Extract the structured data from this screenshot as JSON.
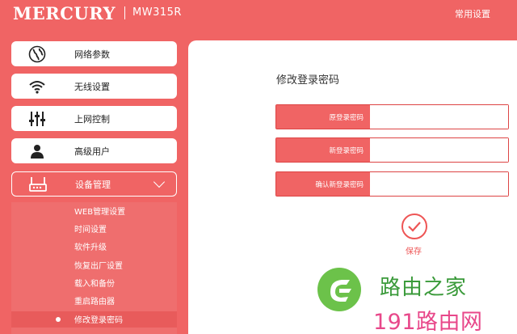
{
  "header": {
    "brand": "MERCURY",
    "model": "MW315R",
    "common_settings": "常用设置"
  },
  "sidebar": {
    "items": [
      {
        "label": "网络参数",
        "icon": "globe-icon"
      },
      {
        "label": "无线设置",
        "icon": "wifi-icon"
      },
      {
        "label": "上网控制",
        "icon": "sliders-icon"
      },
      {
        "label": "高级用户",
        "icon": "user-icon"
      },
      {
        "label": "设备管理",
        "icon": "router-icon",
        "expanded": true
      }
    ],
    "submenu": [
      "WEB管理设置",
      "时间设置",
      "软件升级",
      "恢复出厂设置",
      "载入和备份",
      "重启路由器",
      "修改登录密码"
    ],
    "active_submenu": "修改登录密码"
  },
  "main": {
    "title": "修改登录密码",
    "fields": [
      {
        "label": "原登录密码",
        "value": ""
      },
      {
        "label": "新登录密码",
        "value": ""
      },
      {
        "label": "确认新登录密码",
        "value": ""
      }
    ],
    "save_label": "保存"
  },
  "watermark": {
    "line1": "路由之家",
    "line2": "191路由网"
  },
  "colors": {
    "accent": "#f06464",
    "panel": "#ffffff",
    "watermark_green": "#6cc24a",
    "watermark_pink": "#e8488a"
  }
}
